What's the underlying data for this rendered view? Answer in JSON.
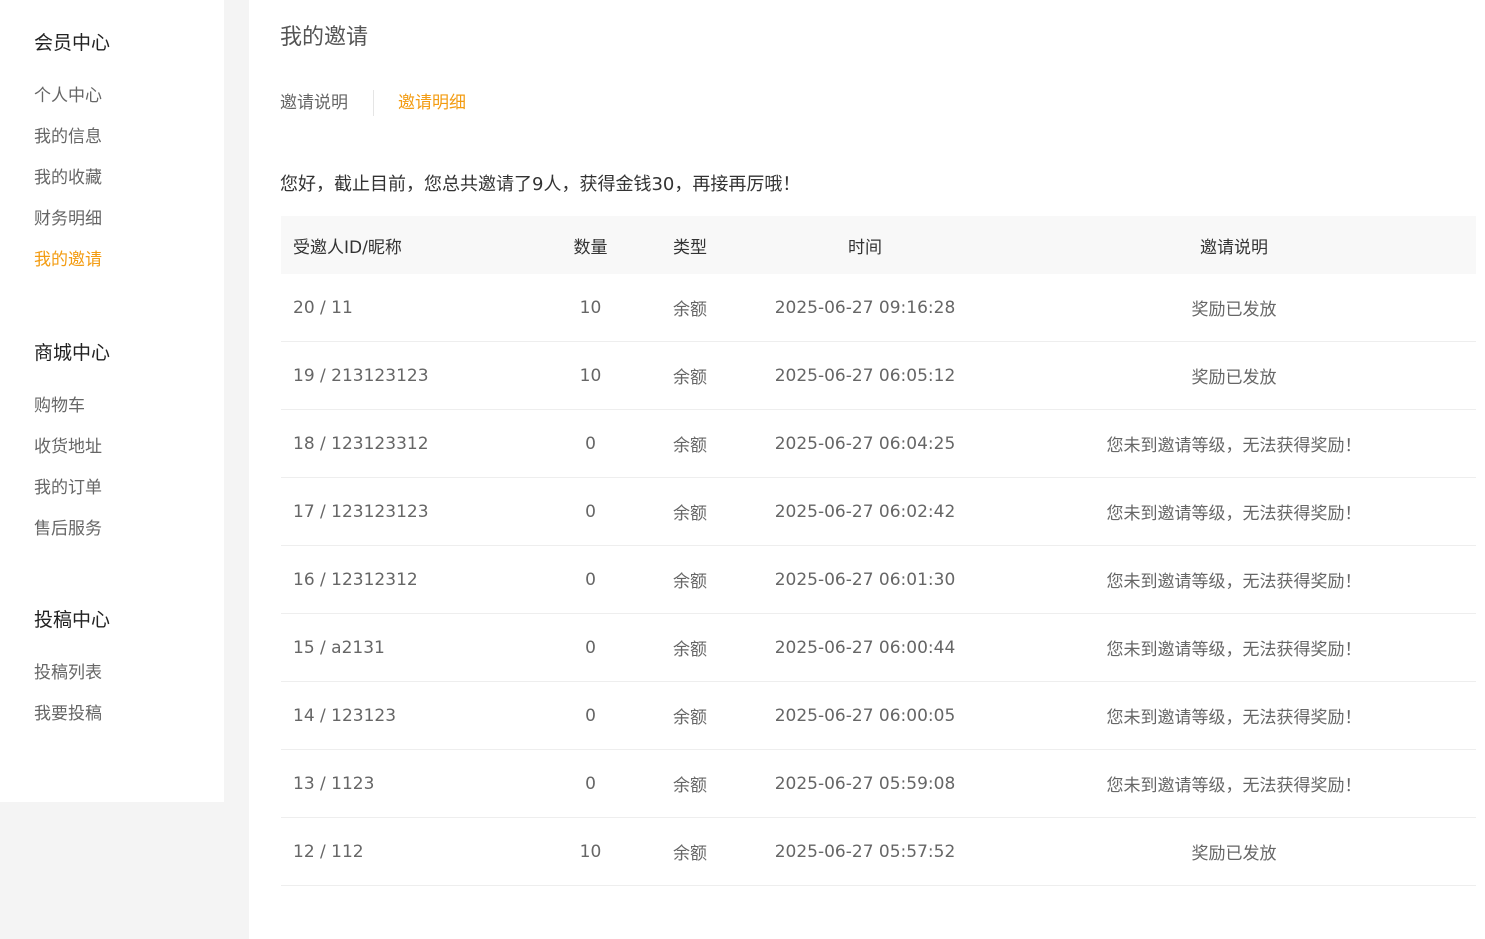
{
  "sidebar": {
    "sections": [
      {
        "heading": "会员中心",
        "items": [
          "个人中心",
          "我的信息",
          "我的收藏",
          "财务明细",
          "我的邀请"
        ]
      },
      {
        "heading": "商城中心",
        "items": [
          "购物车",
          "收货地址",
          "我的订单",
          "售后服务"
        ]
      },
      {
        "heading": "投稿中心",
        "items": [
          "投稿列表",
          "我要投稿"
        ]
      }
    ],
    "active_item": "我的邀请"
  },
  "main": {
    "title": "我的邀请",
    "tabs": [
      {
        "label": "邀请说明"
      },
      {
        "label": "邀请明细"
      }
    ],
    "active_tab": "邀请明细",
    "summary": "您好，截止目前，您总共邀请了9人，获得金钱30，再接再厉哦！",
    "table": {
      "headers": [
        "受邀人ID/昵称",
        "数量",
        "类型",
        "时间",
        "邀请说明"
      ],
      "rows": [
        [
          "20 / 11",
          "10",
          "余额",
          "2025-06-27 09:16:28",
          "奖励已发放"
        ],
        [
          "19 / 213123123",
          "10",
          "余额",
          "2025-06-27 06:05:12",
          "奖励已发放"
        ],
        [
          "18 / 123123312",
          "0",
          "余额",
          "2025-06-27 06:04:25",
          "您未到邀请等级，无法获得奖励！"
        ],
        [
          "17 / 123123123",
          "0",
          "余额",
          "2025-06-27 06:02:42",
          "您未到邀请等级，无法获得奖励！"
        ],
        [
          "16 / 12312312",
          "0",
          "余额",
          "2025-06-27 06:01:30",
          "您未到邀请等级，无法获得奖励！"
        ],
        [
          "15 / a2131",
          "0",
          "余额",
          "2025-06-27 06:00:44",
          "您未到邀请等级，无法获得奖励！"
        ],
        [
          "14 / 123123",
          "0",
          "余额",
          "2025-06-27 06:00:05",
          "您未到邀请等级，无法获得奖励！"
        ],
        [
          "13 / 1123",
          "0",
          "余额",
          "2025-06-27 05:59:08",
          "您未到邀请等级，无法获得奖励！"
        ],
        [
          "12 / 112",
          "10",
          "余额",
          "2025-06-27 05:57:52",
          "奖励已发放"
        ]
      ]
    }
  },
  "colors": {
    "accent": "#f39c12",
    "page_background": "#f4f4f4",
    "header_background": "#f8f8f8"
  }
}
